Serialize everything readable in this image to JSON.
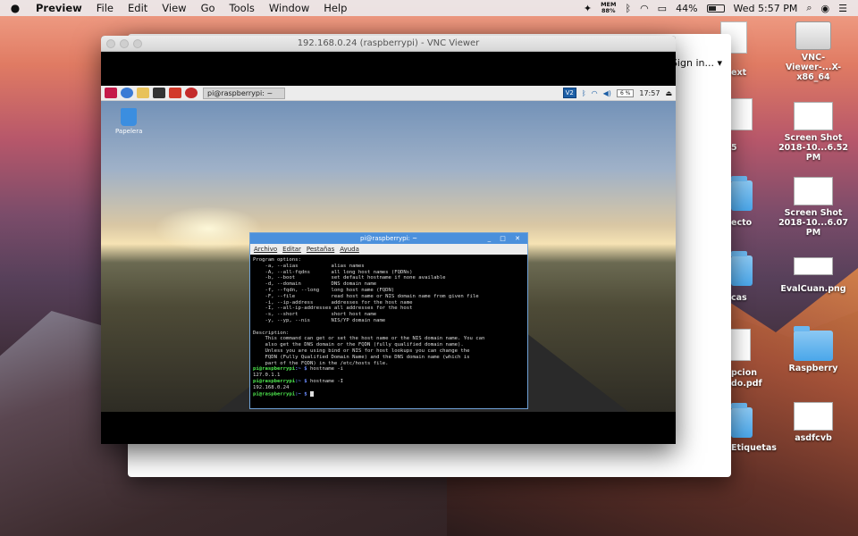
{
  "menubar": {
    "app_name": "Preview",
    "items": [
      "File",
      "Edit",
      "View",
      "Go",
      "Tools",
      "Window",
      "Help"
    ],
    "mem_label": "MEM",
    "mem_value": "88%",
    "battery_percent": "44%",
    "clock": "Wed 5:57 PM"
  },
  "back_window": {
    "signin_label": "Sign in...",
    "signin_arrow": "▾"
  },
  "vnc": {
    "title": "192.168.0.24 (raspberrypi) - VNC Viewer"
  },
  "pi_panel": {
    "task_label": "pi@raspberrypi: ~",
    "vnc_badge": "V2",
    "cpu_label": "6 %",
    "clock": "17:57"
  },
  "pi_desktop": {
    "trash_label": "Papelera"
  },
  "terminal": {
    "title": "pi@raspberrypi: ~",
    "controls": "_ □ ✕",
    "menu": [
      "Archivo",
      "Editar",
      "Pestañas",
      "Ayuda"
    ],
    "help_text": "Program options:\n    -a, --alias           alias names\n    -A, --all-fqdns       all long host names (FQDNs)\n    -b, --boot            set default hostname if none available\n    -d, --domain          DNS domain name\n    -f, --fqdn, --long    long host name (FQDN)\n    -F, --file            read host name or NIS domain name from given file\n    -i, --ip-address      addresses for the host name\n    -I, --all-ip-addresses all addresses for the host\n    -s, --short           short host name\n    -y, --yp, --nis       NIS/YP domain name\n\nDescription:\n    This command can get or set the host name or the NIS domain name. You can\n    also get the DNS domain or the FQDN (fully qualified domain name).\n    Unless you are using bind or NIS for host lookups you can change the\n    FQDN (Fully Qualified Domain Name) and the DNS domain name (which is\n    part of the FQDN) in the /etc/hosts file.",
    "prompt_user": "pi@raspberrypi",
    "prompt_path": ":~ $",
    "cmd1": " hostname -i",
    "out1": "127.0.1.1",
    "cmd2": " hostname -I",
    "out2": "192.168.0.24"
  },
  "desktop_icons": {
    "vnc_viewer": "VNC-\nViewer-...X-x86_64",
    "screenshot1": "Screen Shot\n2018-10...6.52 PM",
    "screenshot2": "Screen Shot\n2018-10...6.07 PM",
    "evalcuan": "EvalCuan.png",
    "raspberry": "Raspberry",
    "asdfcvb": "asdfcvb",
    "partial_ext": "ext",
    "partial_5": "5",
    "partial_ecto": "ecto",
    "partial_cas": "cas",
    "partial_pcion": "pcion\ndo.pdf",
    "partial_etiquetas": "Etiquetas"
  }
}
